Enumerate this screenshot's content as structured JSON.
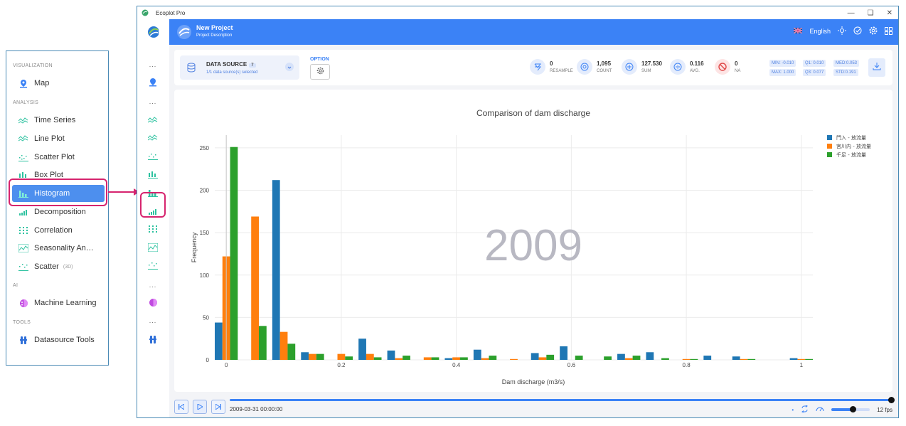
{
  "menu": {
    "sections": [
      {
        "title": "VISUALIZATION",
        "items": [
          {
            "label": "Map",
            "icon": "map-pin-icon"
          }
        ]
      },
      {
        "title": "ANALYSIS",
        "items": [
          {
            "label": "Time Series",
            "icon": "time-series-icon"
          },
          {
            "label": "Line Plot",
            "icon": "line-plot-icon"
          },
          {
            "label": "Scatter Plot",
            "icon": "scatter-plot-icon"
          },
          {
            "label": "Box Plot",
            "icon": "box-plot-icon"
          },
          {
            "label": "Histogram",
            "icon": "histogram-icon",
            "active": true
          },
          {
            "label": "Decomposition",
            "icon": "decomposition-icon"
          },
          {
            "label": "Correlation",
            "icon": "correlation-icon"
          },
          {
            "label": "Seasonality An…",
            "icon": "seasonality-icon"
          },
          {
            "label": "Scatter",
            "sub": "(3D)",
            "icon": "scatter-3d-icon"
          }
        ]
      },
      {
        "title": "AI",
        "items": [
          {
            "label": "Machine Learning",
            "icon": "machine-learning-icon"
          }
        ]
      },
      {
        "title": "TOOLS",
        "items": [
          {
            "label": "Datasource Tools",
            "icon": "datasource-tools-icon"
          }
        ]
      }
    ]
  },
  "window": {
    "title": "Ecoplot Pro"
  },
  "header": {
    "project_name": "New Project",
    "project_description": "Project Description",
    "language": "English"
  },
  "toolbar": {
    "data_source_label": "DATA SOURCE",
    "data_source_count": "7",
    "data_source_sub": "1/1 data source(s) selected",
    "option_label": "OPTION",
    "stats": [
      {
        "value": "0",
        "label": "RESAMPLE",
        "icon": "resample-icon"
      },
      {
        "value": "1,095",
        "label": "COUNT",
        "icon": "count-icon"
      },
      {
        "value": "127.530",
        "label": "SUM",
        "icon": "sum-icon"
      },
      {
        "value": "0.116",
        "label": "AVG.",
        "icon": "average-icon"
      },
      {
        "value": "0",
        "label": "NA",
        "icon": "na-icon"
      }
    ],
    "quantiles": {
      "min": "MIN: -0.010",
      "q1": "Q1:  0.010",
      "med": "MED:0.053",
      "max": "MAX: 1.000",
      "q3": "Q3:  0.077",
      "std": "STD:0.191"
    }
  },
  "chart_data": {
    "type": "bar",
    "title": "Comparison of dam discharge",
    "xlabel": "Dam discharge (m3/s)",
    "ylabel": "Frequency",
    "watermark": "2009",
    "xlim": [
      -0.02,
      1.02
    ],
    "ylim": [
      0,
      265
    ],
    "x_ticks": [
      0,
      0.2,
      0.4,
      0.6,
      0.8,
      1
    ],
    "x_tick_labels": [
      "0",
      "0.2",
      "0.4",
      "0.6",
      "0.8",
      "1"
    ],
    "y_ticks": [
      0,
      50,
      100,
      150,
      200,
      250
    ],
    "bin_width": 0.05,
    "bin_starts": [
      -0.025,
      0.025,
      0.075,
      0.125,
      0.175,
      0.225,
      0.275,
      0.325,
      0.375,
      0.425,
      0.475,
      0.525,
      0.575,
      0.625,
      0.675,
      0.725,
      0.775,
      0.825,
      0.875,
      0.925,
      0.975
    ],
    "grid": true,
    "legend_position": "top-right",
    "series": [
      {
        "name": "門入 - 放流量",
        "color": "#1f77b4",
        "values": [
          44,
          0,
          212,
          9,
          0,
          25,
          11,
          0,
          2,
          12,
          0,
          8,
          16,
          0,
          7,
          9,
          0,
          5,
          4,
          0,
          2
        ]
      },
      {
        "name": "宮川内 - 放流量",
        "color": "#ff7f0e",
        "values": [
          122,
          169,
          33,
          7,
          7,
          7,
          2,
          3,
          3,
          2,
          1,
          3,
          0,
          0,
          2,
          0,
          1,
          0,
          1,
          0,
          1
        ]
      },
      {
        "name": "千足 - 放流量",
        "color": "#2ca02c",
        "values": [
          251,
          40,
          19,
          7,
          4,
          3,
          5,
          3,
          3,
          5,
          0,
          6,
          5,
          4,
          5,
          2,
          1,
          0,
          1,
          0,
          1
        ]
      }
    ]
  },
  "player": {
    "timestamp": "2009-03-31 00:00:00",
    "fps": "12 fps",
    "progress": 1.0,
    "speed": 0.55
  },
  "colors": {
    "accent": "#3b82f6",
    "highlight": "#d6246e",
    "active_menu": "#4d8fee"
  }
}
